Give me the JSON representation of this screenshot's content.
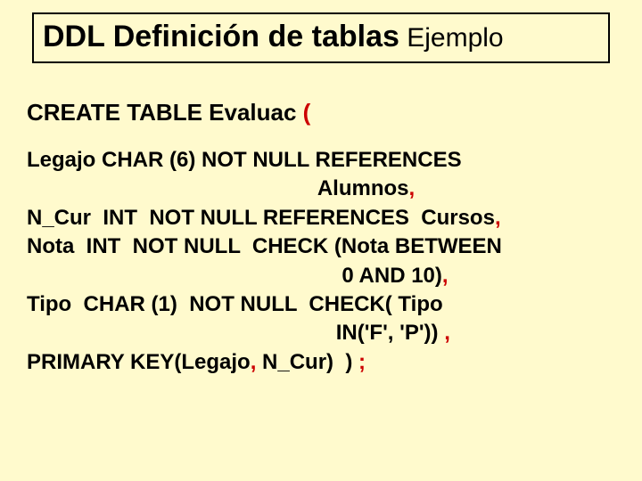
{
  "title": {
    "main": "DDL  Definición de tablas",
    "sub": "  Ejemplo"
  },
  "create": {
    "sql": "CREATE TABLE Evaluac ",
    "paren": " ("
  },
  "lines": {
    "l1": "Legajo CHAR (6) NOT NULL REFERENCES",
    "l2a": "                                                 Alumnos",
    "l2b": ",",
    "l3a": "N_Cur  INT  NOT NULL REFERENCES  Cursos",
    "l3b": ",",
    "l4": "Nota  INT  NOT NULL  CHECK (Nota BETWEEN ",
    "l5a": "                                                     0 AND 10)",
    "l5b": ",",
    "l6": "Tipo  CHAR (1)  NOT NULL  CHECK( Tipo",
    "l7a": "                                                    IN('F', 'P')) ",
    "l7b": ",",
    "l8a": "PRIMARY KEY(Legajo",
    "l8b": ",",
    "l8c": " N_Cur)  ) ",
    "l8d": ";"
  }
}
